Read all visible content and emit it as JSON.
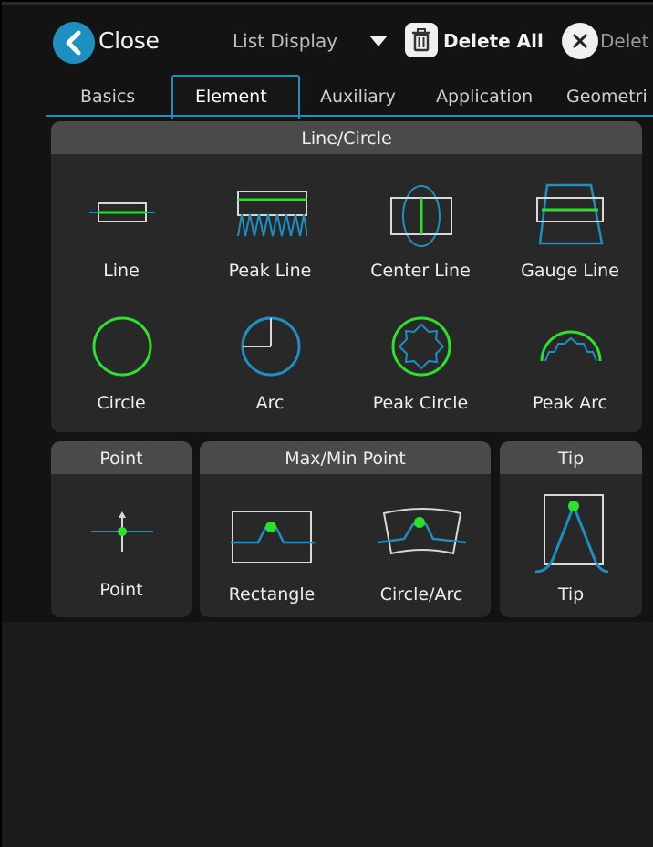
{
  "toolbar": {
    "close_label": "Close",
    "list_display_label": "List Display",
    "delete_all_label": "Delete All",
    "delete_label": "Delet"
  },
  "tabs": [
    {
      "label": "Basics"
    },
    {
      "label": "Element",
      "active": true
    },
    {
      "label": "Auxiliary"
    },
    {
      "label": "Application"
    },
    {
      "label": "Geometri"
    }
  ],
  "sections": {
    "line_circle": {
      "title": "Line/Circle",
      "items": [
        {
          "label": "Line",
          "icon": "line-icon"
        },
        {
          "label": "Peak Line",
          "icon": "peak-line-icon"
        },
        {
          "label": "Center Line",
          "icon": "center-line-icon"
        },
        {
          "label": "Gauge Line",
          "icon": "gauge-line-icon"
        },
        {
          "label": "Circle",
          "icon": "circle-icon"
        },
        {
          "label": "Arc",
          "icon": "arc-icon"
        },
        {
          "label": "Peak Circle",
          "icon": "peak-circle-icon"
        },
        {
          "label": "Peak Arc",
          "icon": "peak-arc-icon"
        }
      ]
    },
    "point": {
      "title": "Point",
      "items": [
        {
          "label": "Point",
          "icon": "point-icon"
        }
      ]
    },
    "max_min": {
      "title": "Max/Min Point",
      "items": [
        {
          "label": "Rectangle",
          "icon": "rectangle-icon"
        },
        {
          "label": "Circle/Arc",
          "icon": "circle-arc-icon"
        }
      ]
    },
    "tip": {
      "title": "Tip",
      "items": [
        {
          "label": "Tip",
          "icon": "tip-icon"
        }
      ]
    }
  },
  "colors": {
    "accent_blue": "#1e8fc1",
    "highlight_green": "#2ee02e",
    "outline_gray": "#d8d8d8"
  }
}
